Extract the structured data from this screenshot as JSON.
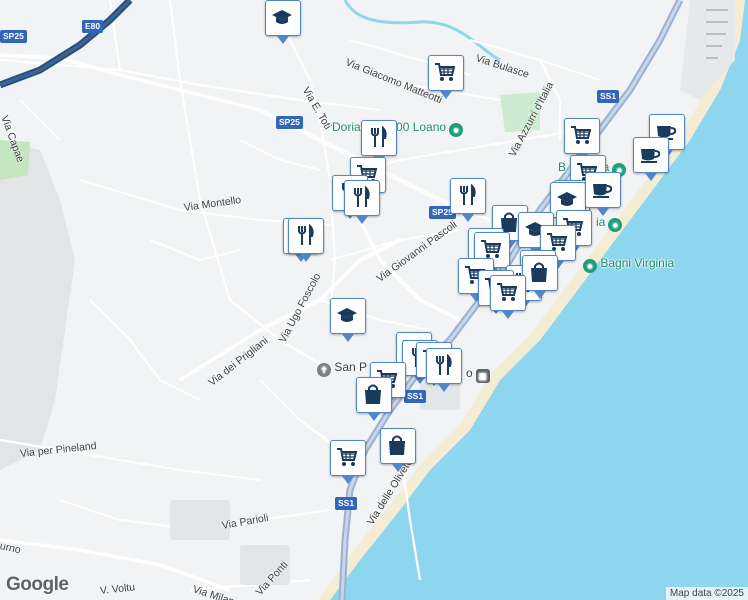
{
  "map": {
    "colors": {
      "land": "#f1f3f4",
      "sea": "#8ed6ee",
      "park": "#cdebd0",
      "green": "#c5e4c0",
      "road": "#ffffff",
      "highway": "#9ab1d3",
      "motorway": "#2b4f7d",
      "marker_border": "#4f87c9",
      "marker_icon": "#1a3a5e"
    },
    "roads": [
      {
        "id": "via-bulasce",
        "label": "Via Bulasce"
      },
      {
        "id": "via-giacomo-matteotti",
        "label": "Via Giacomo Matteotti"
      },
      {
        "id": "via-e-toti",
        "label": "Via E. Toti"
      },
      {
        "id": "via-azzurri",
        "label": "Via Azzurri d'Italia"
      },
      {
        "id": "via-capae",
        "label": "Via Capae"
      },
      {
        "id": "via-montello",
        "label": "Via Montello"
      },
      {
        "id": "via-giovanni-pascoli",
        "label": "Via Giovanni Pascoli"
      },
      {
        "id": "via-ugo-foscolo",
        "label": "Via Ugo Foscolo"
      },
      {
        "id": "via-dei-prigliani",
        "label": "Via dei Prigliani"
      },
      {
        "id": "via-per-pineland",
        "label": "Via per Pineland"
      },
      {
        "id": "via-delle-olivete",
        "label": "Via delle Olivete"
      },
      {
        "id": "via-parioli",
        "label": "Via Parioli"
      },
      {
        "id": "via-milano",
        "label": "Via Milano"
      },
      {
        "id": "via-ponti",
        "label": "Via Ponti"
      },
      {
        "id": "v-volturno",
        "label": "V. Voltu"
      },
      {
        "id": "urno",
        "label": "urno"
      }
    ],
    "shields": [
      {
        "id": "e80",
        "label": "E80"
      },
      {
        "id": "sp25-a",
        "label": "SP25"
      },
      {
        "id": "sp25-b",
        "label": "SP25"
      },
      {
        "id": "sp25-c",
        "label": "SP25"
      },
      {
        "id": "ss1-a",
        "label": "SS1"
      },
      {
        "id": "ss1-b",
        "label": "SS1"
      },
      {
        "id": "ss1-c",
        "label": "SS1"
      }
    ],
    "pois": [
      {
        "id": "doria",
        "label": "Doria Ro 2000 Loano",
        "type": "park"
      },
      {
        "id": "bagni-virginia",
        "label": "Bagni Virginia",
        "type": "beach"
      },
      {
        "id": "bagni-mir",
        "label": "B Mirama",
        "type": "beach"
      },
      {
        "id": "bagni-ia",
        "label": "ia",
        "type": "beach"
      },
      {
        "id": "san-p",
        "label": "San P",
        "type": "church"
      },
      {
        "id": "station",
        "label": "o",
        "type": "station"
      }
    ],
    "markers": [
      {
        "type": "school"
      },
      {
        "type": "grocery"
      },
      {
        "type": "restaurant"
      },
      {
        "type": "grocery"
      },
      {
        "type": "grocery"
      },
      {
        "type": "cafe"
      },
      {
        "type": "cafe"
      },
      {
        "type": "restaurant"
      },
      {
        "type": "restaurant"
      },
      {
        "type": "grocery"
      },
      {
        "type": "restaurant"
      },
      {
        "type": "restaurant"
      },
      {
        "type": "restaurant"
      },
      {
        "type": "grocery"
      },
      {
        "type": "shopping"
      },
      {
        "type": "school"
      },
      {
        "type": "school"
      },
      {
        "type": "grocery"
      },
      {
        "type": "restaurant"
      },
      {
        "type": "grocery"
      },
      {
        "type": "grocery"
      },
      {
        "type": "shopping"
      },
      {
        "type": "grocery"
      },
      {
        "type": "restaurant"
      },
      {
        "type": "grocery"
      },
      {
        "type": "shopping"
      },
      {
        "type": "school"
      },
      {
        "type": "grocery"
      },
      {
        "type": "restaurant"
      },
      {
        "type": "grocery"
      },
      {
        "type": "restaurant"
      },
      {
        "type": "grocery"
      },
      {
        "type": "shopping"
      },
      {
        "type": "shopping"
      },
      {
        "type": "grocery"
      },
      {
        "type": "cafe"
      },
      {
        "type": "grocery"
      }
    ],
    "logo": "Google",
    "attribution": "Map data ©2025"
  }
}
